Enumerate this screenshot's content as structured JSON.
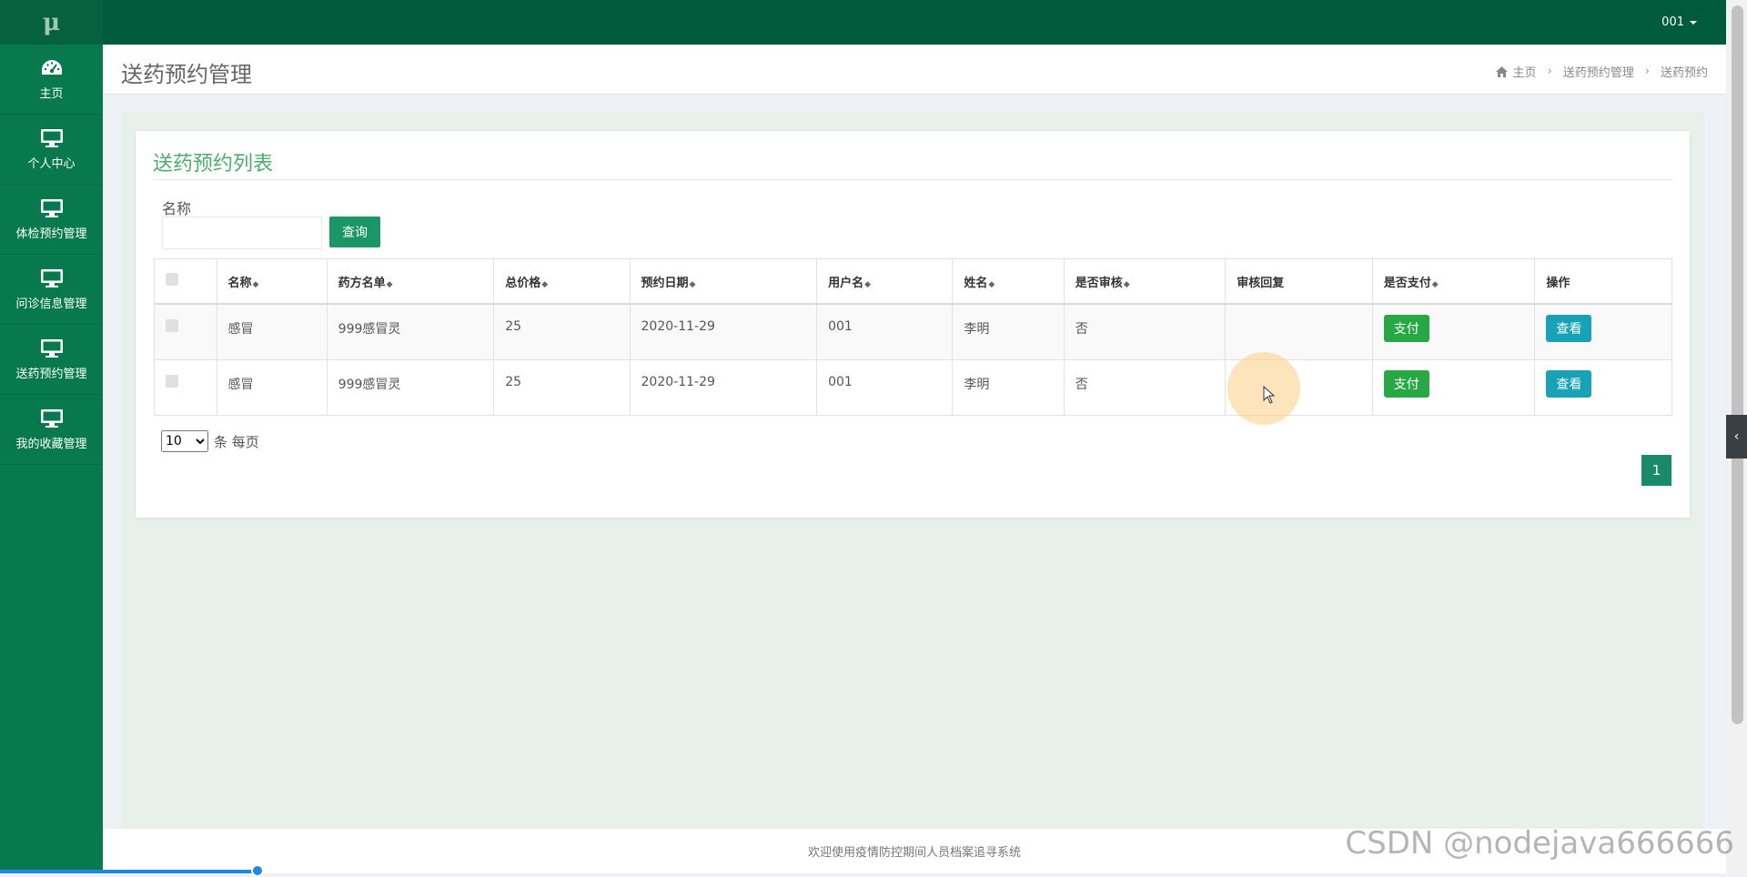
{
  "sidebar": {
    "logo": "μ",
    "items": [
      {
        "label": "主页",
        "icon": "dashboard-icon"
      },
      {
        "label": "个人中心",
        "icon": "monitor-icon"
      },
      {
        "label": "体检预约管理",
        "icon": "monitor-icon"
      },
      {
        "label": "问诊信息管理",
        "icon": "monitor-icon"
      },
      {
        "label": "送药预约管理",
        "icon": "monitor-icon"
      },
      {
        "label": "我的收藏管理",
        "icon": "monitor-icon"
      }
    ]
  },
  "topbar": {
    "user": "001"
  },
  "header": {
    "title": "送药预约管理",
    "breadcrumb": {
      "home": "主页",
      "section": "送药预约管理",
      "current": "送药预约"
    }
  },
  "card": {
    "title": "送药预约列表",
    "search": {
      "label": "名称",
      "value": "",
      "button": "查询"
    }
  },
  "table": {
    "headers": [
      "名称",
      "药方名单",
      "总价格",
      "预约日期",
      "用户名",
      "姓名",
      "是否审核",
      "审核回复",
      "是否支付",
      "操作"
    ],
    "rows": [
      {
        "name": "感冒",
        "prescription": "999感冒灵",
        "price": "25",
        "date": "2020-11-29",
        "username": "001",
        "realname": "李明",
        "reviewed": "否",
        "reply": "",
        "pay": "支付",
        "view": "查看"
      },
      {
        "name": "感冒",
        "prescription": "999感冒灵",
        "price": "25",
        "date": "2020-11-29",
        "username": "001",
        "realname": "李明",
        "reviewed": "否",
        "reply": "",
        "pay": "支付",
        "view": "查看"
      }
    ]
  },
  "pagination": {
    "page_size": "10",
    "page_size_suffix": "条 每页",
    "current_page": "1"
  },
  "footer": {
    "text": "欢迎使用疫情防控期间人员档案追寻系统"
  },
  "watermark": "CSDN @nodejava666666",
  "colors": {
    "sidebar": "#07794d",
    "topbar": "#005a3c",
    "accent": "#1a9667",
    "pay_button": "#28a745",
    "view_button": "#17a2b8"
  }
}
